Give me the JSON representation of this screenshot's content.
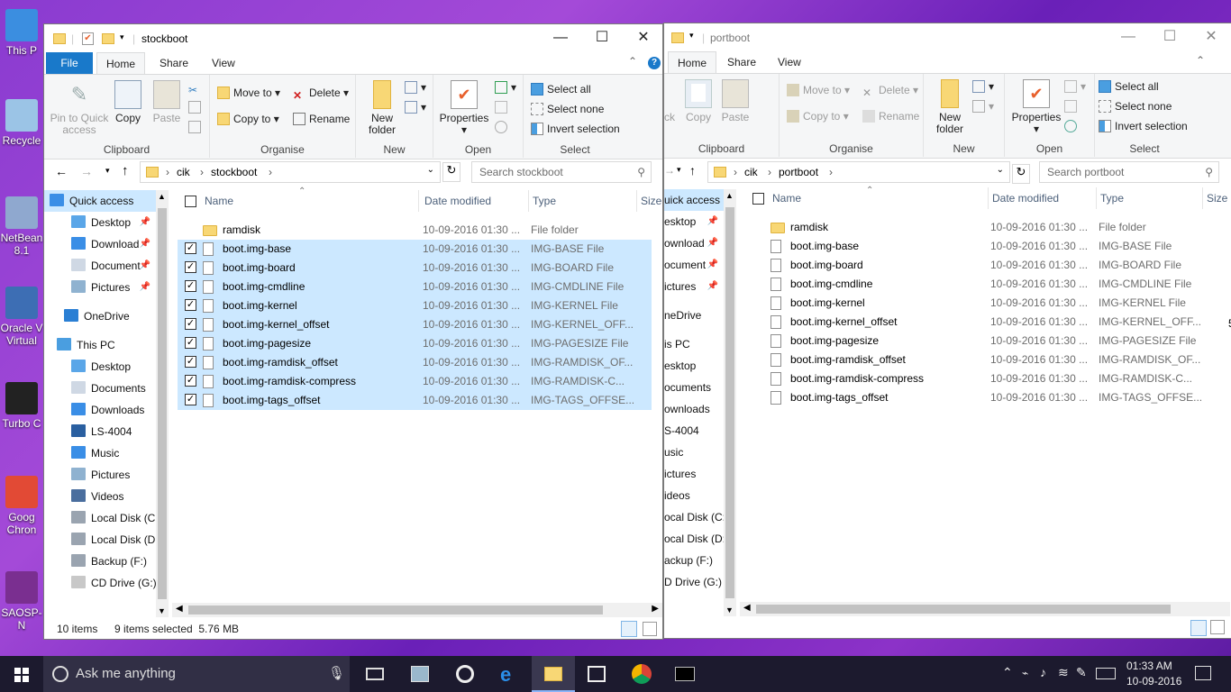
{
  "desktop": {
    "icons": [
      {
        "label": "This P",
        "color": "#3b8ee0"
      },
      {
        "label": "Recycle",
        "color": "#9bc4e6"
      },
      {
        "label": "NetBean 8.1",
        "color": "#8fa8cf"
      },
      {
        "label": "Oracle V Virtual",
        "color": "#3d6eb4"
      },
      {
        "label": "Turbo C",
        "color": "#222222"
      },
      {
        "label": "Goog Chron",
        "color": "#e24a35"
      },
      {
        "label": "SAOSP-N",
        "color": "#7a2f90"
      }
    ]
  },
  "left_window": {
    "title": "stockboot",
    "tabs": [
      "File",
      "Home",
      "Share",
      "View"
    ],
    "ribbon": {
      "clipboard": {
        "pin": "Pin to Quick access",
        "copy": "Copy",
        "paste": "Paste",
        "label": "Clipboard"
      },
      "organise": {
        "move_to": "Move to",
        "copy_to": "Copy to",
        "delete": "Delete",
        "rename": "Rename",
        "label": "Organise"
      },
      "new": {
        "new_folder": "New folder",
        "label": "New"
      },
      "open": {
        "properties": "Properties",
        "label": "Open"
      },
      "select": {
        "select_all": "Select all",
        "select_none": "Select none",
        "invert": "Invert selection",
        "label": "Select"
      }
    },
    "address": {
      "crumbs": [
        "cik",
        "stockboot"
      ],
      "search_placeholder": "Search stockboot"
    },
    "nav": [
      "Quick access",
      "Desktop",
      "Download",
      "Document",
      "Pictures",
      "OneDrive",
      "This PC",
      "Desktop",
      "Documents",
      "Downloads",
      "LS-4004",
      "Music",
      "Pictures",
      "Videos",
      "Local Disk (C:",
      "Local Disk (D:",
      "Backup (F:)",
      "CD Drive (G:)"
    ],
    "columns": {
      "name": "Name",
      "date": "Date modified",
      "type": "Type",
      "size": "Size"
    },
    "rows": [
      {
        "name": "ramdisk",
        "date": "10-09-2016 01:30 ...",
        "type": "File folder",
        "selected": false,
        "folder": true
      },
      {
        "name": "boot.img-base",
        "date": "10-09-2016 01:30 ...",
        "type": "IMG-BASE File",
        "selected": true,
        "folder": false
      },
      {
        "name": "boot.img-board",
        "date": "10-09-2016 01:30 ...",
        "type": "IMG-BOARD File",
        "selected": true,
        "folder": false
      },
      {
        "name": "boot.img-cmdline",
        "date": "10-09-2016 01:30 ...",
        "type": "IMG-CMDLINE File",
        "selected": true,
        "folder": false
      },
      {
        "name": "boot.img-kernel",
        "date": "10-09-2016 01:30 ...",
        "type": "IMG-KERNEL File",
        "selected": true,
        "folder": false
      },
      {
        "name": "boot.img-kernel_offset",
        "date": "10-09-2016 01:30 ...",
        "type": "IMG-KERNEL_OFF...",
        "selected": true,
        "folder": false
      },
      {
        "name": "boot.img-pagesize",
        "date": "10-09-2016 01:30 ...",
        "type": "IMG-PAGESIZE File",
        "selected": true,
        "folder": false
      },
      {
        "name": "boot.img-ramdisk_offset",
        "date": "10-09-2016 01:30 ...",
        "type": "IMG-RAMDISK_OF...",
        "selected": true,
        "folder": false
      },
      {
        "name": "boot.img-ramdisk-compress",
        "date": "10-09-2016 01:30 ...",
        "type": "IMG-RAMDISK-C...",
        "selected": true,
        "folder": false
      },
      {
        "name": "boot.img-tags_offset",
        "date": "10-09-2016 01:30 ...",
        "type": "IMG-TAGS_OFFSE...",
        "selected": true,
        "folder": false
      }
    ],
    "status": {
      "count": "10 items",
      "selected": "9 items selected  5.76 MB"
    }
  },
  "right_window": {
    "title": "portboot",
    "tabs": [
      "Home",
      "Share",
      "View"
    ],
    "ribbon": {
      "clipboard": {
        "pin": "ck",
        "copy": "Copy",
        "paste": "Paste",
        "label": "Clipboard"
      },
      "organise": {
        "move_to": "Move to",
        "copy_to": "Copy to",
        "delete": "Delete",
        "rename": "Rename",
        "label": "Organise"
      },
      "new": {
        "new_folder": "New folder",
        "label": "New"
      },
      "open": {
        "properties": "Properties",
        "label": "Open"
      },
      "select": {
        "select_all": "Select all",
        "select_none": "Select none",
        "invert": "Invert selection",
        "label": "Select"
      }
    },
    "address": {
      "crumbs": [
        "cik",
        "portboot"
      ],
      "search_placeholder": "Search portboot"
    },
    "nav": [
      "uick access",
      "esktop",
      "ownload",
      "ocument",
      "ictures",
      "neDrive",
      "is PC",
      "esktop",
      "ocuments",
      "ownloads",
      "S-4004",
      "usic",
      "ictures",
      "ideos",
      "ocal Disk (C:",
      "ocal Disk (D:",
      "ackup (F:)",
      "D Drive (G:)"
    ],
    "columns": {
      "name": "Name",
      "date": "Date modified",
      "type": "Type",
      "size": "Size"
    },
    "rows": [
      {
        "name": "ramdisk",
        "date": "10-09-2016 01:30 ...",
        "type": "File folder",
        "folder": true
      },
      {
        "name": "boot.img-base",
        "date": "10-09-2016 01:30 ...",
        "type": "IMG-BASE File",
        "folder": false
      },
      {
        "name": "boot.img-board",
        "date": "10-09-2016 01:30 ...",
        "type": "IMG-BOARD File",
        "folder": false
      },
      {
        "name": "boot.img-cmdline",
        "date": "10-09-2016 01:30 ...",
        "type": "IMG-CMDLINE File",
        "folder": false
      },
      {
        "name": "boot.img-kernel",
        "date": "10-09-2016 01:30 ...",
        "type": "IMG-KERNEL File",
        "folder": false
      },
      {
        "name": "boot.img-kernel_offset",
        "date": "10-09-2016 01:30 ...",
        "type": "IMG-KERNEL_OFF...",
        "folder": false
      },
      {
        "name": "boot.img-pagesize",
        "date": "10-09-2016 01:30 ...",
        "type": "IMG-PAGESIZE File",
        "folder": false
      },
      {
        "name": "boot.img-ramdisk_offset",
        "date": "10-09-2016 01:30 ...",
        "type": "IMG-RAMDISK_OF...",
        "folder": false
      },
      {
        "name": "boot.img-ramdisk-compress",
        "date": "10-09-2016 01:30 ...",
        "type": "IMG-RAMDISK-C...",
        "folder": false
      },
      {
        "name": "boot.img-tags_offset",
        "date": "10-09-2016 01:30 ...",
        "type": "IMG-TAGS_OFFSE...",
        "folder": false
      }
    ],
    "size_peek": "5"
  },
  "taskbar": {
    "search_text": "Ask me anything",
    "time": "01:33 AM",
    "date": "10-09-2016"
  },
  "colors": {
    "accent": "#1979ca",
    "selection": "#cce8ff",
    "taskbar": "#1c1a2e"
  }
}
